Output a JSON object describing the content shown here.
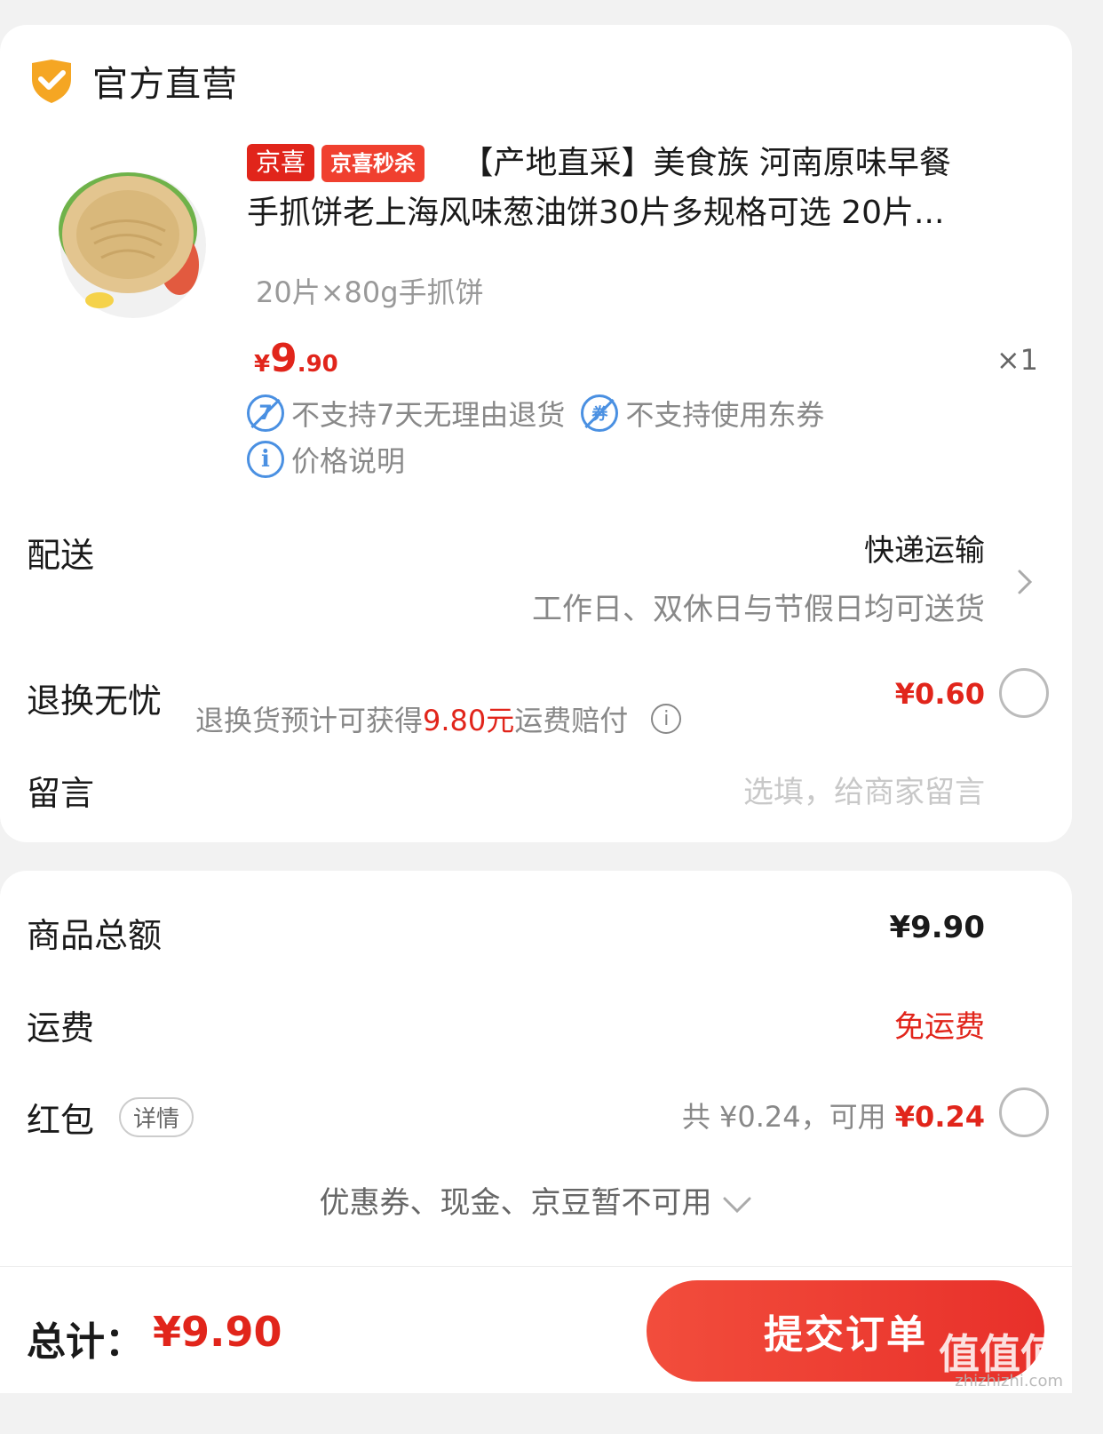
{
  "store": {
    "name": "官方直营",
    "icon": "shield-check-icon",
    "accent": "#f5a623"
  },
  "product": {
    "badges": [
      "京喜",
      "京喜秒杀"
    ],
    "title_line1": "【产地直采】美食族 河南原味早餐",
    "title_line2": "手抓饼老上海风味葱油饼30片多规格可选 20片...",
    "spec": "20片×80g手抓饼",
    "price_currency": "¥",
    "price_int": "9",
    "price_dec": ".90",
    "qty": "×1",
    "services": [
      "不支持7天无理由退货",
      "不支持使用东券"
    ],
    "price_note": "价格说明"
  },
  "delivery": {
    "label": "配送",
    "method": "快递运输",
    "note": "工作日、双休日与节假日均可送货"
  },
  "refund": {
    "label": "退换无忧",
    "desc_prefix": "退换货预计可获得",
    "desc_amount": "9.80元",
    "desc_suffix": "运费赔付",
    "price": "¥0.60"
  },
  "message": {
    "label": "留言",
    "placeholder": "选填，给商家留言"
  },
  "summary": {
    "goods_label": "商品总额",
    "goods_value": "¥9.90",
    "shipping_label": "运费",
    "shipping_value": "免运费",
    "redpacket_label": "红包",
    "redpacket_detail": "详情",
    "redpacket_total": "共 ¥0.24，可用",
    "redpacket_avail": "¥0.24",
    "unavailable": "优惠券、现金、京豆暂不可用"
  },
  "footer": {
    "total_label": "总计：",
    "total_value": "¥9.90",
    "submit": "提交订单",
    "watermark": "值值值",
    "watermark_sub": "zhizhizhi.com"
  },
  "colors": {
    "red": "#e1251b",
    "blue": "#4a90e2"
  }
}
